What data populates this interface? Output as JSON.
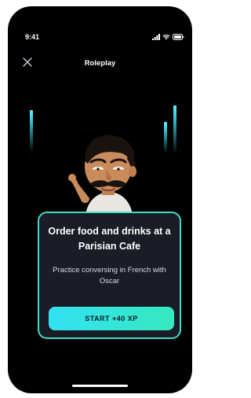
{
  "status_bar": {
    "time": "9:41",
    "icons": [
      "signal-icon",
      "wifi-icon",
      "battery-icon"
    ]
  },
  "header": {
    "title": "Roleplay",
    "close_icon": "close-icon"
  },
  "scene": {
    "character_name": "Oscar",
    "accent_color": "#3ee0c3"
  },
  "card": {
    "title": "Order food and drinks at a Parisian Cafe",
    "subtitle": "Practice conversing in French with Oscar",
    "button_label": "START +40 XP",
    "border_color": "#3ee0c3",
    "button_gradient": [
      "#33e2f2",
      "#36e8c0"
    ]
  }
}
